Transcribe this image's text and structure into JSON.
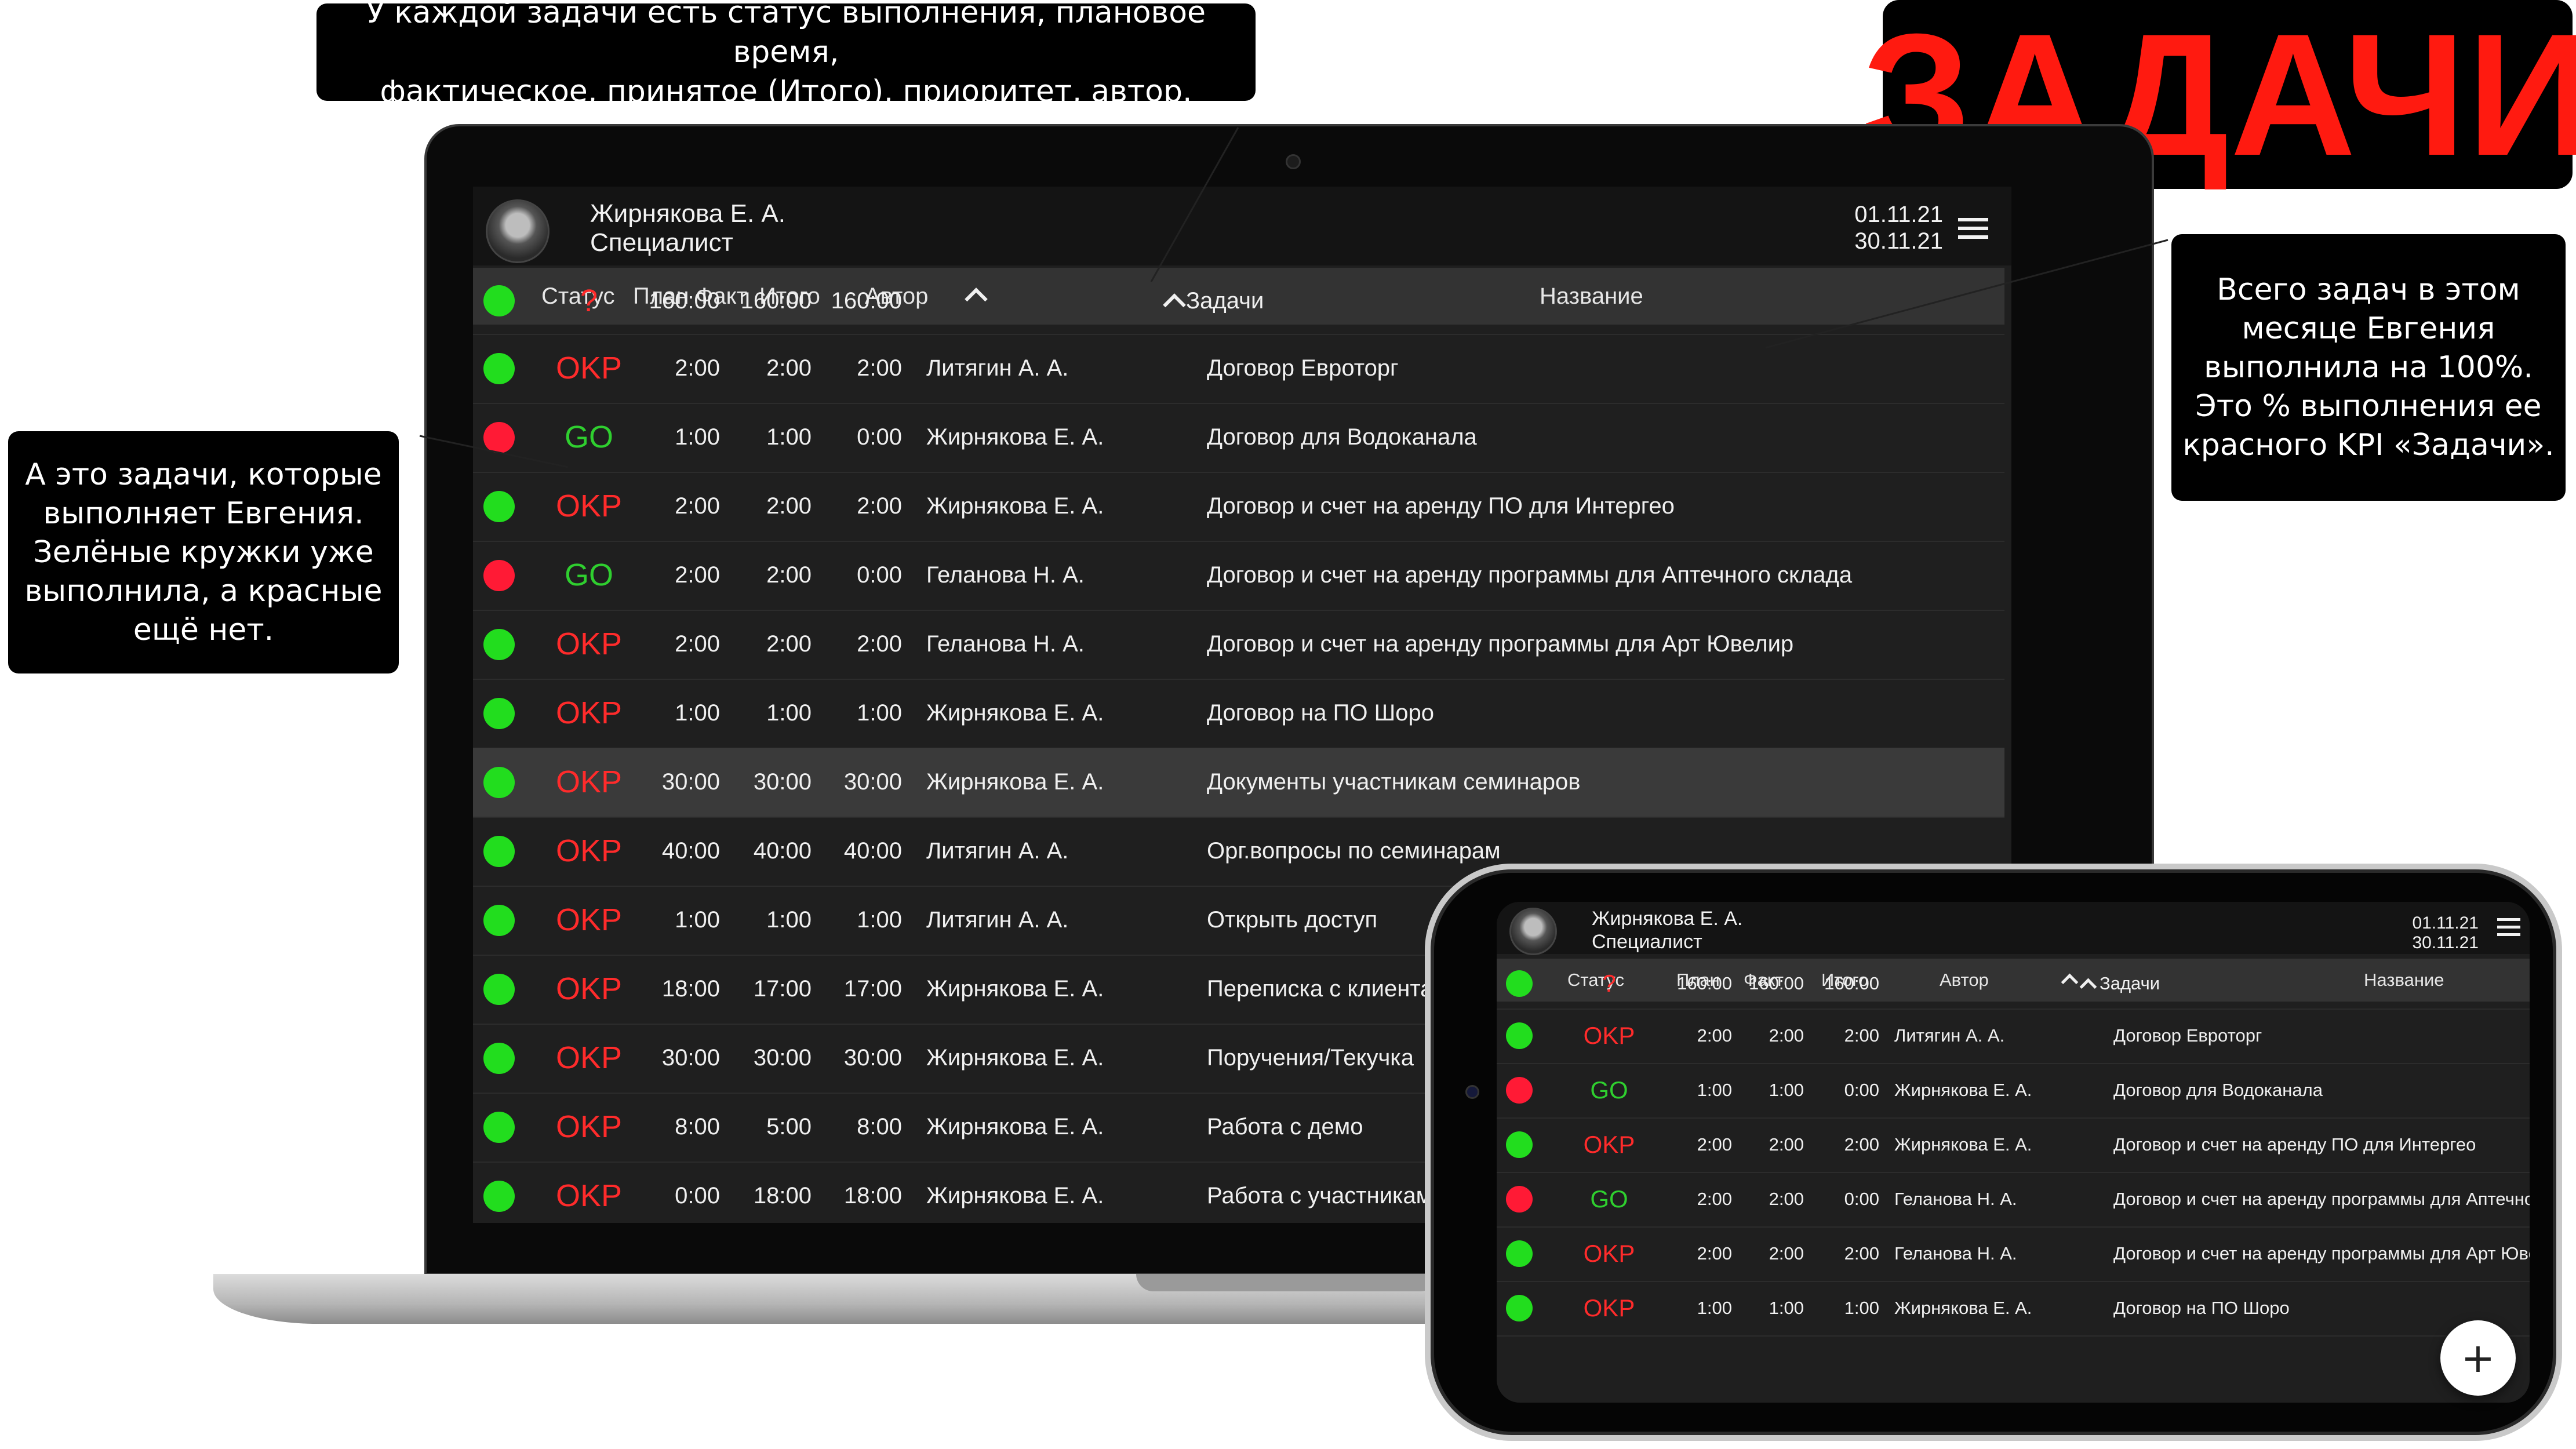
{
  "callouts": {
    "top": [
      "У каждой задачи есть статус выполнения, плановое время,",
      "фактическое, принятое (Итого), приоритет, автор."
    ],
    "left": [
      "А это задачи, которые",
      "выполняет Евгения.",
      "Зелёные кружки уже",
      "выполнила, а красные",
      "ещё нет."
    ],
    "right": [
      "Всего задач в этом",
      "месяце Евгения",
      "выполнила на 100%.",
      "Это % выполнения ее",
      "красного KPI «Задачи»."
    ],
    "title": "ЗАДАЧИ"
  },
  "colors": {
    "accent_red": "#ff1a10",
    "status_done": "#22dd1e",
    "status_pending": "#ff1a35",
    "okr_text": "#ff2b2b",
    "go_text": "#2fcf2f",
    "screen_bg": "#1f1f1f"
  },
  "laptop": {
    "user": {
      "name": "Жирнякова Е. А.",
      "role": "Специалист"
    },
    "period": {
      "from": "01.11.21",
      "to": "30.11.21"
    },
    "icons": {
      "menu": "hamburger-menu-icon",
      "sort": "chevron-up-icon"
    },
    "columns": {
      "status": "Статус",
      "plan": "План",
      "fact": "Факт",
      "total": "Итого",
      "author": "Автор",
      "name": "Название"
    },
    "summary": {
      "dot": "green",
      "status": "?",
      "plan": "160:00",
      "fact": "160:00",
      "total": "160:00",
      "name": "Задачи"
    },
    "rows": [
      {
        "dot": "green",
        "status": "OKP",
        "plan": "2:00",
        "fact": "2:00",
        "total": "2:00",
        "author": "Литягин А. А.",
        "name": "Договор Евроторг"
      },
      {
        "dot": "red",
        "status": "GO",
        "plan": "1:00",
        "fact": "1:00",
        "total": "0:00",
        "author": "Жирнякова Е. А.",
        "name": "Договор для Водоканала"
      },
      {
        "dot": "green",
        "status": "OKP",
        "plan": "2:00",
        "fact": "2:00",
        "total": "2:00",
        "author": "Жирнякова Е. А.",
        "name": "Договор и счет на аренду ПО для Интергео"
      },
      {
        "dot": "red",
        "status": "GO",
        "plan": "2:00",
        "fact": "2:00",
        "total": "0:00",
        "author": "Геланова Н. А.",
        "name": "Договор и счет на аренду программы для Аптечного склада"
      },
      {
        "dot": "green",
        "status": "OKP",
        "plan": "2:00",
        "fact": "2:00",
        "total": "2:00",
        "author": "Геланова Н. А.",
        "name": "Договор и счет на аренду программы для Арт Ювелир"
      },
      {
        "dot": "green",
        "status": "OKP",
        "plan": "1:00",
        "fact": "1:00",
        "total": "1:00",
        "author": "Жирнякова Е. А.",
        "name": "Договор на ПО Шоро"
      },
      {
        "dot": "green",
        "status": "OKP",
        "plan": "30:00",
        "fact": "30:00",
        "total": "30:00",
        "author": "Жирнякова Е. А.",
        "name": "Документы участникам семинаров"
      },
      {
        "dot": "green",
        "status": "OKP",
        "plan": "40:00",
        "fact": "40:00",
        "total": "40:00",
        "author": "Литягин А. А.",
        "name": "Орг.вопросы по семинарам"
      },
      {
        "dot": "green",
        "status": "OKP",
        "plan": "1:00",
        "fact": "1:00",
        "total": "1:00",
        "author": "Литягин А. А.",
        "name": "Открыть доступ"
      },
      {
        "dot": "green",
        "status": "OKP",
        "plan": "18:00",
        "fact": "17:00",
        "total": "17:00",
        "author": "Жирнякова Е. А.",
        "name": "Переписка с клиентами"
      },
      {
        "dot": "green",
        "status": "OKP",
        "plan": "30:00",
        "fact": "30:00",
        "total": "30:00",
        "author": "Жирнякова Е. А.",
        "name": "Поручения/Текучка"
      },
      {
        "dot": "green",
        "status": "OKP",
        "plan": "8:00",
        "fact": "5:00",
        "total": "8:00",
        "author": "Жирнякова Е. А.",
        "name": "Работа с демо"
      },
      {
        "dot": "green",
        "status": "OKP",
        "plan": "0:00",
        "fact": "18:00",
        "total": "18:00",
        "author": "Жирнякова Е. А.",
        "name": "Работа с участниками"
      }
    ]
  },
  "phone": {
    "user": {
      "name": "Жирнякова Е. А.",
      "role": "Специалист"
    },
    "period": {
      "from": "01.11.21",
      "to": "30.11.21"
    },
    "columns": {
      "status": "Статус",
      "plan": "План",
      "fact": "Факт",
      "total": "Итого",
      "author": "Автор",
      "name": "Название"
    },
    "summary": {
      "dot": "green",
      "status": "?",
      "plan": "160:00",
      "fact": "160:00",
      "total": "160:00",
      "name": "Задачи"
    },
    "rows": [
      {
        "dot": "green",
        "status": "OKP",
        "plan": "2:00",
        "fact": "2:00",
        "total": "2:00",
        "author": "Литягин А. А.",
        "name": "Договор Евроторг"
      },
      {
        "dot": "red",
        "status": "GO",
        "plan": "1:00",
        "fact": "1:00",
        "total": "0:00",
        "author": "Жирнякова Е. А.",
        "name": "Договор для Водоканала"
      },
      {
        "dot": "green",
        "status": "OKP",
        "plan": "2:00",
        "fact": "2:00",
        "total": "2:00",
        "author": "Жирнякова Е. А.",
        "name": "Договор и счет на аренду ПО для Интергео"
      },
      {
        "dot": "red",
        "status": "GO",
        "plan": "2:00",
        "fact": "2:00",
        "total": "0:00",
        "author": "Геланова Н. А.",
        "name": "Договор и счет на аренду программы для Аптечного склада"
      },
      {
        "dot": "green",
        "status": "OKP",
        "plan": "2:00",
        "fact": "2:00",
        "total": "2:00",
        "author": "Геланова Н. А.",
        "name": "Договор и счет на аренду программы для Арт Ювелир"
      },
      {
        "dot": "green",
        "status": "OKP",
        "plan": "1:00",
        "fact": "1:00",
        "total": "1:00",
        "author": "Жирнякова Е. А.",
        "name": "Договор на ПО Шоро"
      }
    ],
    "fab": "+",
    "icons": {
      "menu": "hamburger-menu-icon",
      "fab": "plus-icon"
    }
  }
}
